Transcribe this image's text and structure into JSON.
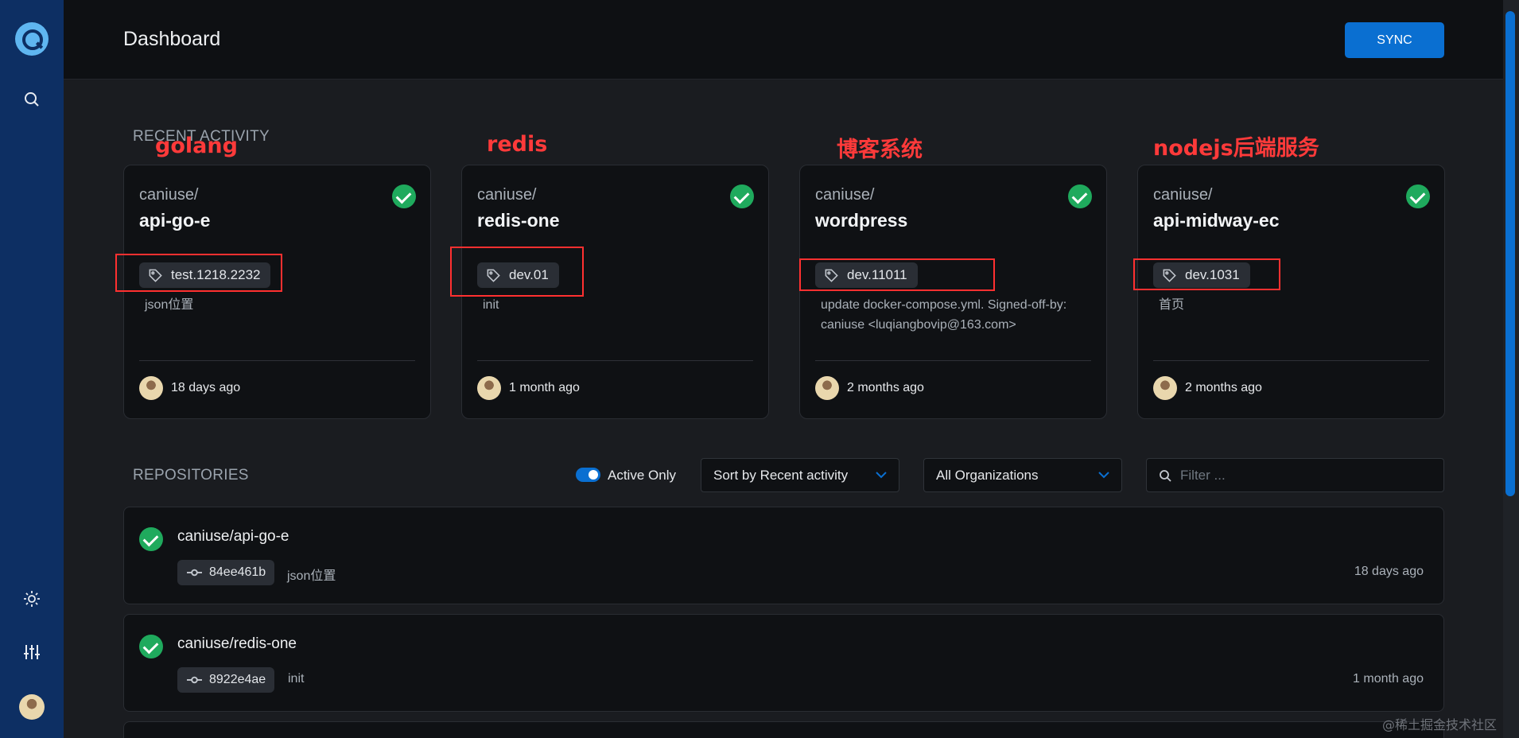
{
  "header": {
    "title": "Dashboard",
    "sync_label": "SYNC"
  },
  "sections": {
    "recent_activity": "RECENT ACTIVITY",
    "repositories": "REPOSITORIES"
  },
  "activity_cards": [
    {
      "owner": "caniuse/",
      "repo": "api-go-e",
      "tag": "test.1218.2232",
      "message": "json位置",
      "when": "18 days ago",
      "annotation": "golang"
    },
    {
      "owner": "caniuse/",
      "repo": "redis-one",
      "tag": "dev.01",
      "message": "init",
      "when": "1 month ago",
      "annotation": "redis"
    },
    {
      "owner": "caniuse/",
      "repo": "wordpress",
      "tag": "dev.11011",
      "message": "update docker-compose.yml. Signed-off-by: caniuse <luqiangbovip@163.com>",
      "when": "2 months ago",
      "annotation": "博客系统"
    },
    {
      "owner": "caniuse/",
      "repo": "api-midway-ec",
      "tag": "dev.1031",
      "message": "首页",
      "when": "2 months ago",
      "annotation": "nodejs后端服务"
    }
  ],
  "controls": {
    "active_only_label": "Active Only",
    "active_only": true,
    "sort_value": "Sort by Recent activity",
    "org_value": "All Organizations",
    "filter_placeholder": "Filter ..."
  },
  "repositories": [
    {
      "name": "caniuse/api-go-e",
      "commit": "84ee461b",
      "message": "json位置",
      "when": "18 days ago"
    },
    {
      "name": "caniuse/redis-one",
      "commit": "8922e4ae",
      "message": "init",
      "when": "1 month ago"
    }
  ],
  "watermark": "@稀土掘金技术社区",
  "colors": {
    "sidebar": "#0d2f63",
    "accent": "#0a6fd1",
    "success": "#1faa5d",
    "annotation": "#ff3030"
  }
}
